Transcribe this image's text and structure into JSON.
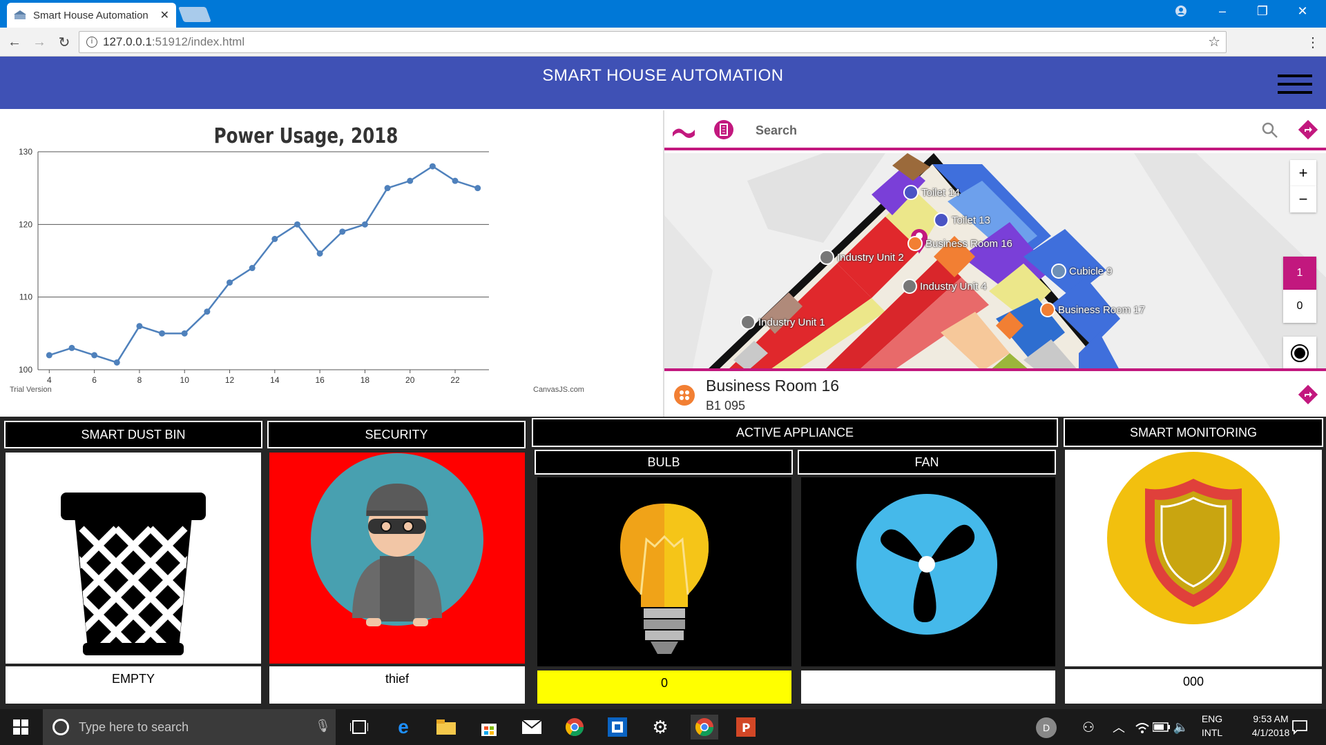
{
  "browser": {
    "tab_title": "Smart House Automation",
    "url_host": "127.0.0.1",
    "url_rest": ":51912/index.html"
  },
  "header": {
    "title": "SMART HOUSE AUTOMATION"
  },
  "chart_data": {
    "type": "line",
    "title": "Power Usage, 2018",
    "xlabel": "",
    "ylabel": "",
    "x": [
      4,
      5,
      6,
      7,
      8,
      9,
      10,
      11,
      12,
      13,
      14,
      15,
      16,
      17,
      18,
      19,
      20,
      21,
      22,
      23
    ],
    "values": [
      102,
      103,
      102,
      101,
      106,
      105,
      105,
      108,
      112,
      114,
      118,
      120,
      116,
      119,
      120,
      125,
      126,
      128,
      126,
      125
    ],
    "xlim": [
      3.5,
      23.5
    ],
    "ylim": [
      100,
      130
    ],
    "x_ticks": [
      4,
      6,
      8,
      10,
      12,
      14,
      16,
      18,
      20,
      22
    ],
    "y_ticks": [
      100,
      110,
      120,
      130
    ],
    "grid": true,
    "line_color": "#4f81bc",
    "watermark_left": "Trial Version",
    "watermark_right": "CanvasJS.com"
  },
  "map": {
    "search_placeholder": "Search",
    "zoom_in": "+",
    "zoom_out": "−",
    "floors": [
      "1",
      "0"
    ],
    "accent": "#c2187e",
    "labels": {
      "toilet14": "Toilet 14",
      "toilet13": "Toilet 13",
      "business16": "Business Room 16",
      "industry2": "Industry Unit 2",
      "cubicle9": "Cubicle 9",
      "industry4": "Industry Unit 4",
      "business17": "Business Room 17",
      "industry1": "Industry Unit 1"
    },
    "selected_room": "Business Room 16",
    "selected_code": "B1 095"
  },
  "dashboard": {
    "dustbin": {
      "title": "SMART DUST BIN",
      "value": "EMPTY"
    },
    "security": {
      "title": "SECURITY",
      "value": "thief"
    },
    "appliance": {
      "title": "ACTIVE APPLIANCE",
      "bulb_title": "BULB",
      "fan_title": "FAN",
      "bulb_value": "0",
      "fan_value": ""
    },
    "monitoring": {
      "title": "SMART MONITORING",
      "value": "000"
    }
  },
  "taskbar": {
    "search_placeholder": "Type here to search",
    "lang_top": "ENG",
    "lang_bottom": "INTL",
    "time": "9:53 AM",
    "date": "4/1/2018",
    "user_initial": "D"
  }
}
